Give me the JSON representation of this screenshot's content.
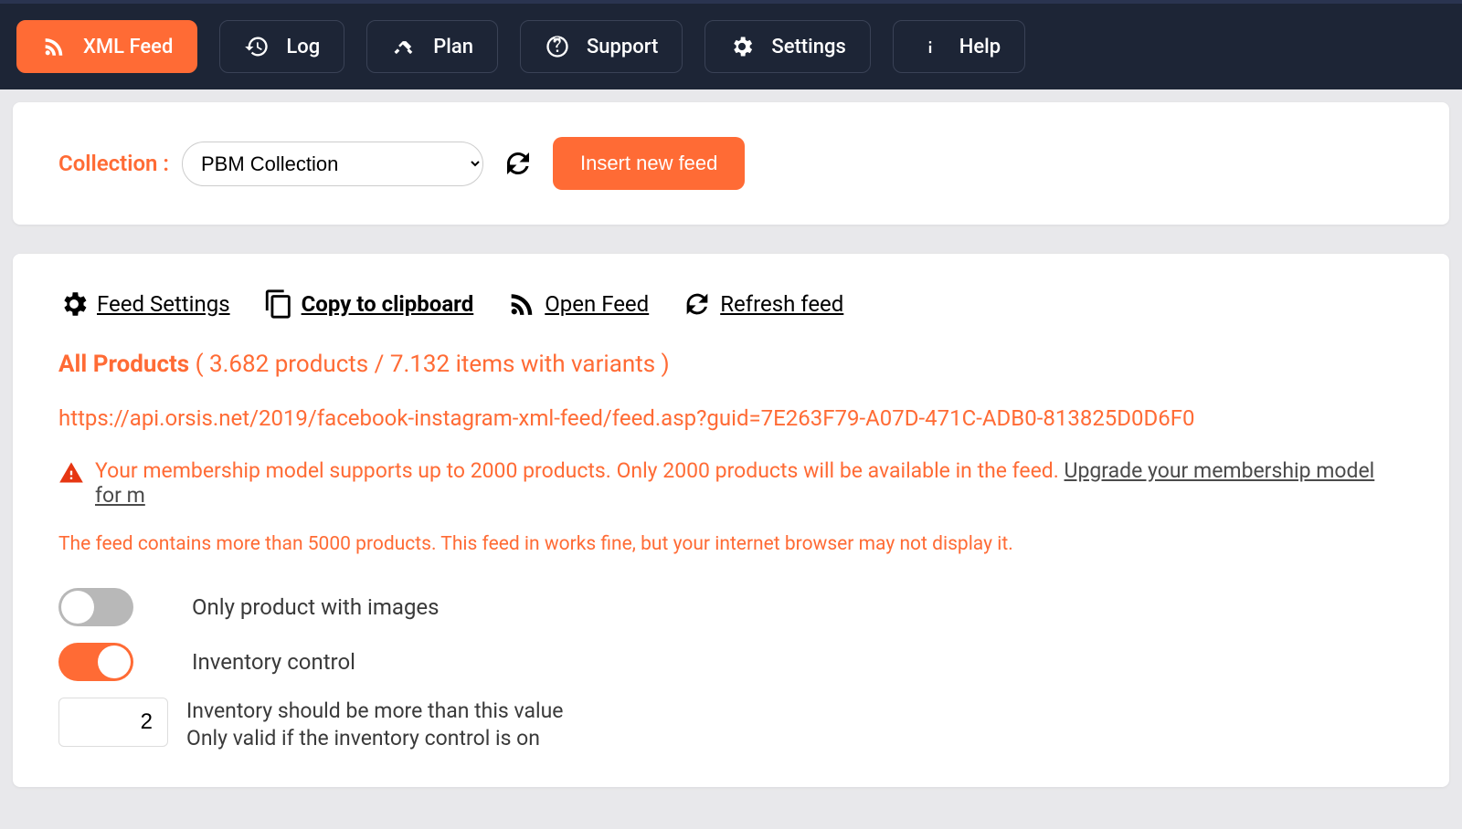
{
  "nav": {
    "xml_feed": "XML Feed",
    "log": "Log",
    "plan": "Plan",
    "support": "Support",
    "settings": "Settings",
    "help": "Help"
  },
  "collection": {
    "label": "Collection :",
    "selected": "PBM Collection",
    "insert_btn": "Insert new feed"
  },
  "actions": {
    "feed_settings": " Feed Settings",
    "copy": " Copy to clipboard",
    "open_feed": " Open Feed",
    "refresh_feed": " Refresh feed"
  },
  "products": {
    "title": "All Products",
    "stats": " ( 3.682 products / 7.132 items with variants )"
  },
  "feed_url": "https://api.orsis.net/2019/facebook-instagram-xml-feed/feed.asp?guid=7E263F79-A07D-471C-ADB0-813825D0D6F0",
  "warning": {
    "text": "Your membership model supports up to 2000 products. Only 2000 products will be available in the feed. ",
    "link": "Upgrade your membership model for m"
  },
  "feed_note": "The feed contains more than 5000 products. This feed in works fine, but your internet browser may not display it.",
  "options": {
    "only_images": "Only product with images",
    "inventory_control": "Inventory control",
    "inventory_value": "2",
    "inventory_desc_l1": "Inventory should be more than this value",
    "inventory_desc_l2": "Only valid if the inventory control is on"
  }
}
